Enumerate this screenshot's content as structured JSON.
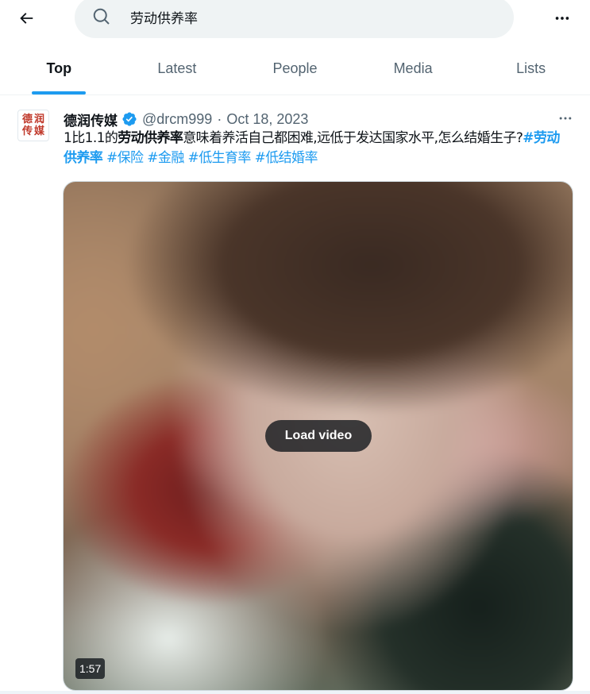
{
  "search": {
    "value": "劳动供养率"
  },
  "tabs": [
    {
      "label": "Top",
      "active": true
    },
    {
      "label": "Latest",
      "active": false
    },
    {
      "label": "People",
      "active": false
    },
    {
      "label": "Media",
      "active": false
    },
    {
      "label": "Lists",
      "active": false
    }
  ],
  "tweet": {
    "avatar_glyphs": [
      "德",
      "润",
      "传",
      "媒"
    ],
    "display_name": "德润传媒",
    "handle": "@drcm999",
    "separator": "·",
    "date": "Oct 18, 2023",
    "text": {
      "part1": "1比1.1的",
      "highlight": "劳动供养率",
      "part2": "意味着养活自己都困难,远低于发达国家水平,怎么结婚生子?",
      "hashtags": [
        "#劳动供养率",
        "#保险",
        "#金融",
        "#低生育率",
        "#低结婚率"
      ]
    },
    "video": {
      "load_label": "Load video",
      "duration": "1:57"
    }
  },
  "colors": {
    "accent": "#1d9bf0",
    "text_primary": "#0f1419",
    "text_secondary": "#536471",
    "search_bg": "#eff3f4"
  },
  "icons": [
    "arrow-left-icon",
    "search-icon",
    "more-icon",
    "verified-badge-icon"
  ]
}
